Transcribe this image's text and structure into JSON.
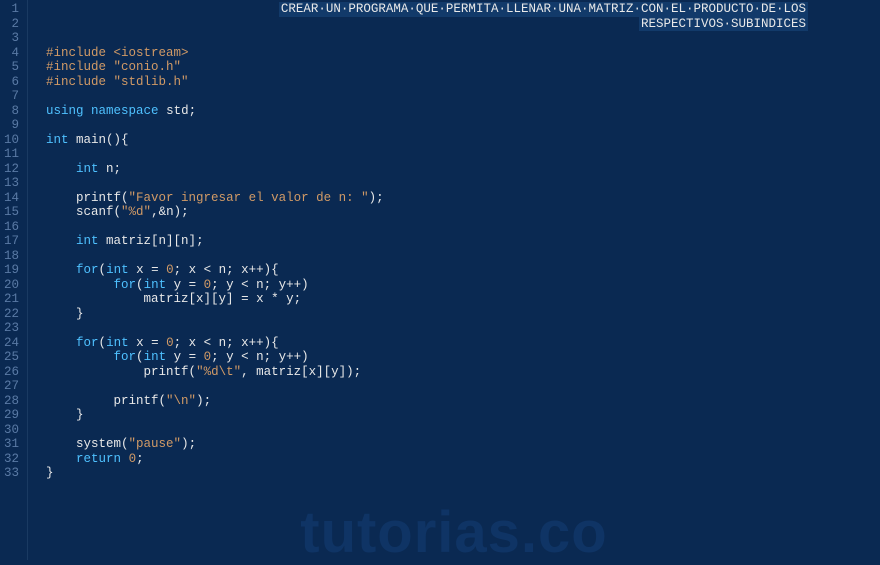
{
  "header": {
    "line1": "CREAR·UN·PROGRAMA·QUE·PERMITA·LLENAR·UNA·MATRIZ·CON·EL·PRODUCTO·DE·LOS",
    "line2": "RESPECTIVOS·SUBINDICES"
  },
  "watermark": "tutorias.co",
  "line_count": 33,
  "code": {
    "l1": "",
    "l2": "",
    "l3": "",
    "l4_pre": "#include ",
    "l4_lib": "<iostream>",
    "l5_pre": "#include ",
    "l5_lib": "\"conio.h\"",
    "l6_pre": "#include ",
    "l6_lib": "\"stdlib.h\"",
    "l7": "",
    "l8_kw1": "using",
    "l8_kw2": "namespace",
    "l8_id": " std;",
    "l9": "",
    "l10_type": "int",
    "l10_rest": " main(){",
    "l11": "",
    "l12_indent": "    ",
    "l12_type": "int",
    "l12_rest": " n;",
    "l13": "",
    "l14_indent": "    ",
    "l14_fn": "printf(",
    "l14_str": "\"Favor ingresar el valor de n: \"",
    "l14_end": ");",
    "l15_indent": "    ",
    "l15_fn": "scanf(",
    "l15_str": "\"%d\"",
    "l15_end": ",&n);",
    "l16": "",
    "l17_indent": "    ",
    "l17_type": "int",
    "l17_rest": " matriz[n][n];",
    "l18": "",
    "l19_indent": "    ",
    "l19_kw": "for",
    "l19_a": "(",
    "l19_type": "int",
    "l19_b": " x = ",
    "l19_num": "0",
    "l19_c": "; x < n; x++){",
    "l20_indent": "         ",
    "l20_kw": "for",
    "l20_a": "(",
    "l20_type": "int",
    "l20_b": " y = ",
    "l20_num": "0",
    "l20_c": "; y < n; y++)",
    "l21_indent": "             ",
    "l21_rest": "matriz[x][y] = x * y;",
    "l22_indent": "    ",
    "l22_rest": "}",
    "l23": "",
    "l24_indent": "    ",
    "l24_kw": "for",
    "l24_a": "(",
    "l24_type": "int",
    "l24_b": " x = ",
    "l24_num": "0",
    "l24_c": "; x < n; x++){",
    "l25_indent": "         ",
    "l25_kw": "for",
    "l25_a": "(",
    "l25_type": "int",
    "l25_b": " y = ",
    "l25_num": "0",
    "l25_c": "; y < n; y++)",
    "l26_indent": "             ",
    "l26_fn": "printf(",
    "l26_str": "\"%d\\t\"",
    "l26_end": ", matriz[x][y]);",
    "l27": "",
    "l28_indent": "         ",
    "l28_fn": "printf(",
    "l28_str": "\"\\n\"",
    "l28_end": ");",
    "l29_indent": "    ",
    "l29_rest": "}",
    "l30": "",
    "l31_indent": "    ",
    "l31_fn": "system(",
    "l31_str": "\"pause\"",
    "l31_end": ");",
    "l32_indent": "    ",
    "l32_kw": "return",
    "l32_sp": " ",
    "l32_num": "0",
    "l32_end": ";",
    "l33": "}"
  }
}
